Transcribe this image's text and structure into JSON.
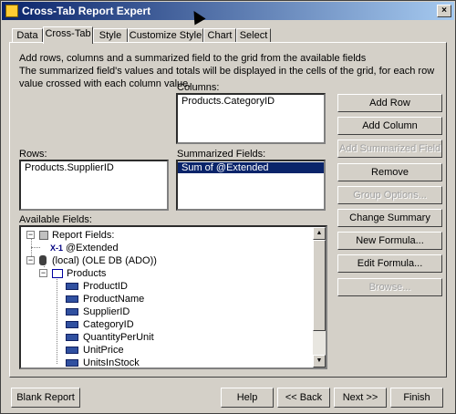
{
  "window": {
    "title": "Cross-Tab Report Expert",
    "close_label": "×"
  },
  "tabs": [
    "Data",
    "Cross-Tab",
    "Style",
    "Customize Style",
    "Chart",
    "Select"
  ],
  "instructions": {
    "line1": "Add rows, columns and a summarized field to the grid from the available fields",
    "line2": "The summarized field's values and totals will be displayed in the cells of the grid, for each row value crossed with each column value."
  },
  "columns": {
    "label": "Columns:",
    "items": [
      "Products.CategoryID"
    ]
  },
  "rows": {
    "label": "Rows:",
    "items": [
      "Products.SupplierID"
    ]
  },
  "summarized": {
    "label": "Summarized Fields:",
    "items": [
      "Sum of @Extended"
    ]
  },
  "available": {
    "label": "Available Fields:",
    "report_fields": "Report Fields:",
    "extended": "@Extended",
    "datasource": "(local) (OLE DB (ADO))",
    "table": "Products",
    "fields": [
      "ProductID",
      "ProductName",
      "SupplierID",
      "CategoryID",
      "QuantityPerUnit",
      "UnitPrice",
      "UnitsInStock"
    ],
    "formula_glyph": "X-1"
  },
  "buttons": {
    "add_row": "Add Row",
    "add_column": "Add Column",
    "add_summarized": "Add Summarized Field",
    "remove": "Remove",
    "group_options": "Group Options...",
    "change_summary": "Change Summary",
    "new_formula": "New Formula...",
    "edit_formula": "Edit Formula...",
    "browse": "Browse..."
  },
  "bottom": {
    "blank_report": "Blank Report",
    "help": "Help",
    "back": "<< Back",
    "next": "Next >>",
    "finish": "Finish"
  }
}
